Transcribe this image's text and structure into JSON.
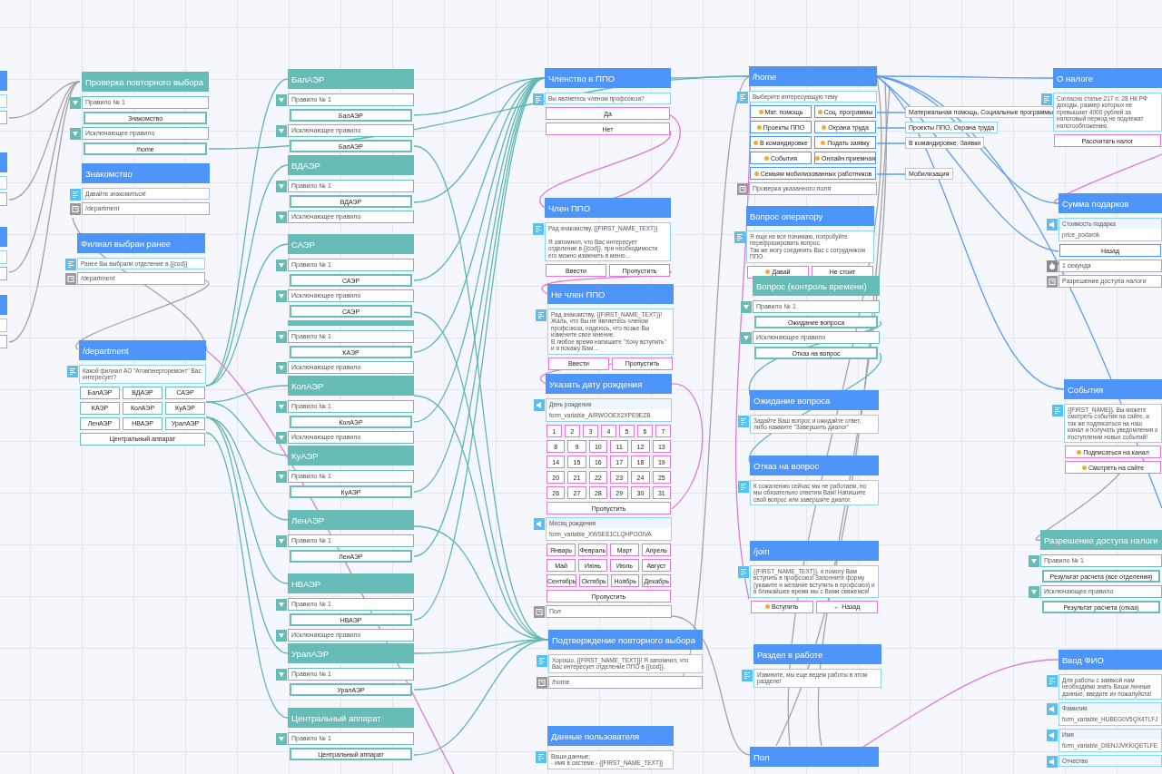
{
  "nodes": [
    {
      "kind": "condition",
      "title": "Проверка повторного выбора",
      "rows": [
        {
          "kind": "rule",
          "text": "Правило № 1"
        },
        {
          "kind": "branch",
          "label": "Знакомство"
        },
        {
          "kind": "rule",
          "text": "Исключающее правило"
        },
        {
          "kind": "branch",
          "label": "/home"
        }
      ]
    },
    {
      "kind": "message",
      "title": "Знакомство",
      "rows": [
        {
          "kind": "text",
          "text": "Давайте знакомиться!"
        },
        {
          "kind": "goto",
          "text": "/department"
        }
      ]
    },
    {
      "kind": "message",
      "title": "Филиал выбран ранее",
      "rows": [
        {
          "kind": "text",
          "text": "Ранее Вы выбрали отделение в {{cod}}"
        },
        {
          "kind": "goto",
          "text": "/department"
        }
      ]
    },
    {
      "kind": "message",
      "title": "/department",
      "rows": [
        {
          "kind": "text",
          "text": "Какой филиал АО \"Атомэнергоремонт\" Вас интересует?"
        },
        {
          "kind": "inline",
          "rows": [
            [
              "БалАЭР",
              "ВДАЭР",
              "САЭР"
            ],
            [
              "КАЭР",
              "КолАЭР",
              "КуАЭР"
            ],
            [
              "ЛенАЭР",
              "НВАЭР",
              "УралАЭР"
            ]
          ]
        },
        {
          "kind": "inline",
          "rows": [
            [
              "Центральный аппарат"
            ]
          ]
        }
      ]
    },
    {
      "kind": "condition",
      "title": "БалАЭР",
      "rows": [
        {
          "kind": "rule",
          "text": "Правило № 1"
        },
        {
          "kind": "branch",
          "label": "БалАЭР"
        },
        {
          "kind": "rule",
          "text": "Исключающее правило"
        },
        {
          "kind": "branch",
          "label": "БалАЭР"
        }
      ]
    },
    {
      "kind": "condition",
      "title": "ВДАЭР",
      "rows": [
        {
          "kind": "rule",
          "text": "Правило № 1"
        },
        {
          "kind": "branch",
          "label": "ВДАЭР"
        },
        {
          "kind": "rule",
          "text": "Исключающее правило"
        }
      ]
    },
    {
      "kind": "condition",
      "title": "САЭР",
      "rows": [
        {
          "kind": "rule",
          "text": "Правило № 1"
        },
        {
          "kind": "branch",
          "label": "САЭР"
        },
        {
          "kind": "rule",
          "text": "Исключающее правило"
        },
        {
          "kind": "branch",
          "label": "САЭР"
        }
      ]
    },
    {
      "kind": "condition",
      "rows": [
        {
          "kind": "rule",
          "text": "Правило № 1"
        },
        {
          "kind": "branch",
          "label": "КАЭР"
        },
        {
          "kind": "rule",
          "text": "Исключающее правило"
        }
      ]
    },
    {
      "kind": "condition",
      "title": "КолАЭР",
      "rows": [
        {
          "kind": "rule",
          "text": "Правило № 1"
        },
        {
          "kind": "branch",
          "label": "КолАЭР"
        },
        {
          "kind": "rule",
          "text": "Исключающее правило"
        }
      ]
    },
    {
      "kind": "condition",
      "title": "КуАЭР",
      "rows": [
        {
          "kind": "rule",
          "text": "Правило № 1"
        },
        {
          "kind": "branch",
          "label": "КуАЭР"
        }
      ]
    },
    {
      "kind": "condition",
      "title": "ЛенАЭР",
      "rows": [
        {
          "kind": "rule",
          "text": "Правило № 1"
        },
        {
          "kind": "branch",
          "label": "ЛенАЭР"
        }
      ]
    },
    {
      "kind": "condition",
      "title": "НВАЭР",
      "rows": [
        {
          "kind": "rule",
          "text": "Правило № 1"
        },
        {
          "kind": "branch",
          "label": "НВАЭР"
        },
        {
          "kind": "rule",
          "text": "Исключающее правило"
        }
      ]
    },
    {
      "kind": "condition",
      "title": "УралАЭР",
      "rows": [
        {
          "kind": "rule",
          "text": "Правило № 1"
        },
        {
          "kind": "branch",
          "label": "УралАЭР"
        }
      ]
    },
    {
      "kind": "condition",
      "title": "Центральный аппарат",
      "rows": [
        {
          "kind": "rule",
          "text": "Правило № 1"
        },
        {
          "kind": "branch",
          "label": "Центральный аппарат"
        }
      ]
    },
    {
      "kind": "message",
      "title": "Членство в ППО",
      "rows": [
        {
          "kind": "text",
          "text": "Вы являетесь членом профсоюза?"
        },
        {
          "kind": "reply",
          "rows": [
            [
              "Да"
            ],
            [
              "Нет"
            ]
          ]
        }
      ]
    },
    {
      "kind": "message",
      "title": "Член ППО",
      "rows": [
        {
          "kind": "text",
          "text": "Рад знакомству, {{FIRST_NAME_TEXT}}\n\nЯ запомнил, что Вас интересует отделение в {{cod}}, при необходимости его можно изменить в меню..."
        },
        {
          "kind": "reply",
          "rows": [
            [
              "Ввести",
              "Пропустить"
            ]
          ]
        }
      ]
    },
    {
      "kind": "message",
      "title": "Не член ППО",
      "rows": [
        {
          "kind": "text",
          "text": "Рад знакомству, {{FIRST_NAME_TEXT}}! Жаль, что Вы не являетесь членом профсоюза, надеюсь, что позже Вы измените свое мнение.\nВ любое время напишите \"Хочу вступить\" и я покажу Вам..."
        },
        {
          "kind": "reply",
          "rows": [
            [
              "Ввести",
              "Пропустить"
            ]
          ]
        }
      ]
    },
    {
      "kind": "message",
      "title": "Указать дату рождения",
      "rows": [
        {
          "kind": "input",
          "label": "День рождения",
          "value": "form_variable_AIRWOOEX2XPE9EZB"
        },
        {
          "kind": "reply",
          "rows": [
            [
              "1",
              "2",
              "3",
              "4",
              "5",
              "6",
              "7"
            ]
          ]
        },
        {
          "kind": "reply",
          "rows": [
            [
              "8",
              "9",
              "10",
              "11",
              "12",
              "13"
            ],
            [
              "14",
              "15",
              "16",
              "17",
              "18",
              "19"
            ],
            [
              "20",
              "21",
              "22",
              "23",
              "24",
              "25"
            ],
            [
              "26",
              "27",
              "28",
              "29",
              "30",
              "31"
            ]
          ]
        },
        {
          "kind": "reply",
          "rows": [
            [
              "Пропустить"
            ]
          ]
        },
        {
          "kind": "input",
          "label": "Месяц рождения",
          "value": "form_variable_XWSEE1CLQHPOOIVA"
        },
        {
          "kind": "reply",
          "rows": [
            [
              "Январь",
              "Февраль",
              "Март",
              "Апрель"
            ],
            [
              "Май",
              "Июнь",
              "Июль",
              "Август"
            ],
            [
              "Сентябрь",
              "Октябрь",
              "Ноябрь",
              "Декабрь"
            ]
          ]
        },
        {
          "kind": "reply",
          "rows": [
            [
              "Пропустить"
            ]
          ]
        },
        {
          "kind": "goto",
          "text": "Пол"
        }
      ]
    },
    {
      "kind": "message",
      "title": "Подтверждение повторного выбора",
      "rows": [
        {
          "kind": "text",
          "text": "Хорошо, {{FIRST_NAME_TEXT}}! Я запомнил, что Вас интересует отделение ППО в {{cod}}."
        },
        {
          "kind": "goto",
          "text": "/home"
        }
      ]
    },
    {
      "kind": "message",
      "title": "Данные пользователя",
      "rows": [
        {
          "kind": "text",
          "text": "Ваши данные:\n- имя в системе - {{FIRST_NAME_TEXT}}"
        }
      ]
    },
    {
      "kind": "message",
      "title": "/home",
      "rows": [
        {
          "kind": "text",
          "text": "Выберите интересующую тему"
        },
        {
          "kind": "inline",
          "rows": [
            [
              {
                "label": "Мат. помощь",
                "emoji": true
              },
              {
                "label": "Соц. программы",
                "emoji": true
              }
            ],
            [
              {
                "label": "Проекты ППО",
                "emoji": true
              },
              {
                "label": "Охрана труда",
                "emoji": true
              }
            ],
            [
              {
                "label": "В командировке",
                "emoji": true
              },
              {
                "label": "Подать заявку",
                "emoji": true
              }
            ],
            [
              {
                "label": "События",
                "emoji": true
              },
              {
                "label": "Онлайн приемная",
                "emoji": true
              }
            ]
          ]
        },
        {
          "kind": "inline",
          "rows": [
            [
              {
                "label": "Семьям мобилизованных работников",
                "emoji": true
              }
            ]
          ]
        },
        {
          "kind": "goto",
          "text": "Проверка указанного поля"
        }
      ]
    },
    {
      "kind": "message",
      "title": "Вопрос оператору",
      "rows": [
        {
          "kind": "text",
          "text": "Я еще не все понимаю, попробуйте перефразировать вопрос.\nТак же могу соединить Вас с сотрудником ППО."
        },
        {
          "kind": "reply",
          "rows": [
            [
              {
                "label": "Давай",
                "emoji": true
              },
              "Не стоит"
            ]
          ]
        }
      ]
    },
    {
      "kind": "condition",
      "title": "Вопрос (контроль времени)",
      "rows": [
        {
          "kind": "rule",
          "text": "Правило № 1"
        },
        {
          "kind": "branch",
          "label": "Ожидание вопроса"
        },
        {
          "kind": "rule",
          "text": "Исключающее правило"
        },
        {
          "kind": "branch",
          "label": "Отказ на вопрос"
        }
      ]
    },
    {
      "kind": "message",
      "title": "Ожидание вопроса",
      "rows": [
        {
          "kind": "text",
          "text": "Задайте Ваш вопрос и ожидайте ответ, либо нажмите \"Завершить диалог\""
        }
      ]
    },
    {
      "kind": "message",
      "title": "Отказ на вопрос",
      "rows": [
        {
          "kind": "text",
          "text": "К сожалению сейчас мы не работаем, но мы обязательно ответим Вам! Напишите свой вопрос или завершите диалог."
        }
      ]
    },
    {
      "kind": "message",
      "title": "/join",
      "rows": [
        {
          "kind": "text",
          "text": "{{FIRST_NAME_TEXT}}, я помогу Вам вступить в профсоюз! Заполните форму (укажите и желание вступить в профсоюз) и в ближайшее время мы с Вами свяжемся!"
        },
        {
          "kind": "reply",
          "rows": [
            [
              {
                "label": "Вступить",
                "emoji": true
              },
              "← Назад"
            ]
          ]
        }
      ]
    },
    {
      "kind": "message",
      "title": "Раздел в работе",
      "rows": [
        {
          "kind": "text",
          "text": "Извините, мы еще ведем работы в этом разделе!"
        }
      ]
    },
    {
      "kind": "message",
      "title": "Пол"
    },
    {
      "kind": "message",
      "title": "О налоге",
      "rows": [
        {
          "kind": "text",
          "text": "Согласно статье 217 п. 28 НК РФ доходы, размер которых не превышает 4000 рублей за налоговый период не подлежат налогообложению."
        },
        {
          "kind": "reply",
          "rows": [
            [
              "Рассчитать налог"
            ]
          ]
        }
      ]
    },
    {
      "kind": "message",
      "title": "Сумма подарков",
      "rows": [
        {
          "kind": "input",
          "label": "Стоимость подарка",
          "value": "price_podarok"
        },
        {
          "kind": "inline",
          "rows": [
            [
              "Назад"
            ]
          ]
        },
        {
          "kind": "timer",
          "text": "1 секунда"
        },
        {
          "kind": "goto",
          "text": "Разрешение доступа налоги"
        }
      ]
    },
    {
      "kind": "message",
      "title": "События",
      "rows": [
        {
          "kind": "text",
          "text": "{{FIRST_NAME}}, Вы можете смотреть события на сайте, а так же подписаться на наш канал и получать уведомления о поступлении новых событий!"
        },
        {
          "kind": "reply",
          "rows": [
            [
              {
                "label": "Подписаться на канал",
                "emoji": true
              }
            ],
            [
              {
                "label": "Смотреть на сайте",
                "emoji": true
              }
            ]
          ]
        }
      ]
    },
    {
      "kind": "condition",
      "title": "Разрешение доступа налоги",
      "rows": [
        {
          "kind": "rule",
          "text": "Правило № 1"
        },
        {
          "kind": "branch",
          "label": "Результат расчета (все отделения)"
        },
        {
          "kind": "rule",
          "text": "Исключающее правило"
        },
        {
          "kind": "branch",
          "label": "Результат расчета (отказ)"
        }
      ]
    },
    {
      "kind": "message",
      "title": "Ввод ФИО",
      "rows": [
        {
          "kind": "text",
          "text": "Для работы с заявкой нам необходимо знать Ваши личные данные, введите их пожалуйста!"
        },
        {
          "kind": "input",
          "label": "Фамилия",
          "value": "form_variable_HUBEG0V5QX4TLFJ"
        },
        {
          "kind": "input",
          "label": "Имя",
          "value": "form_variable_DIENJJVKKIQETLFE"
        },
        {
          "kind": "input",
          "label": "Отчество"
        }
      ]
    }
  ],
  "notes": [
    {
      "text": "Материальная помощь, Социальные программы"
    },
    {
      "text": "Проекты ППО, Охрана труда"
    },
    {
      "text": "В командировке, Заявки"
    },
    {
      "text": "Мобилизация"
    }
  ]
}
